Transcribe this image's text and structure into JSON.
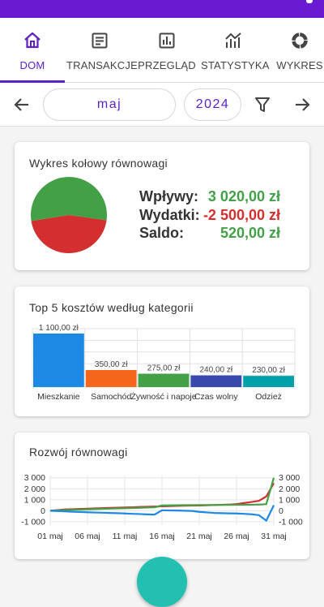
{
  "colors": {
    "status_bar": "#6a1bd1",
    "accent": "#5b21c9",
    "income": "#43a047",
    "expense": "#d32f2f",
    "fab": "#22c0b0"
  },
  "tabs": [
    {
      "label": "DOM",
      "icon": "home-icon",
      "active": true
    },
    {
      "label": "TRANSAKCJE",
      "icon": "list-icon",
      "active": false
    },
    {
      "label": "PRZEGLĄD",
      "icon": "bar-chart-icon",
      "active": false
    },
    {
      "label": "STATYSTYKA",
      "icon": "trend-chart-icon",
      "active": false
    },
    {
      "label": "WYKRES",
      "icon": "donut-chart-icon",
      "active": false
    }
  ],
  "date_filter": {
    "month": "maj",
    "year": "2024",
    "prev_icon": "arrow-left-icon",
    "next_icon": "arrow-right-icon",
    "filter_icon": "filter-icon"
  },
  "balance_card": {
    "title": "Wykres kołowy równowagi",
    "income_label": "Wpływy:",
    "income_value": "3 020,00 zł",
    "expense_label": "Wydatki:",
    "expense_value": "-2 500,00 zł",
    "balance_label": "Saldo:",
    "balance_value": "520,00 zł"
  },
  "top_costs_card": {
    "title": "Top 5 kosztów według kategorii"
  },
  "trend_card": {
    "title": "Rozwój równowagi"
  },
  "chart_data": [
    {
      "type": "pie",
      "title": "Wykres kołowy równowagi",
      "categories": [
        "Wpływy",
        "Wydatki"
      ],
      "values": [
        3020,
        2500
      ],
      "colors": [
        "#43a047",
        "#d32f2f"
      ]
    },
    {
      "type": "bar",
      "title": "Top 5 kosztów według kategorii",
      "categories": [
        "Mieszkanie",
        "Samochód",
        "Żywność i napoje",
        "Czas wolny",
        "Odzież"
      ],
      "values": [
        1100,
        350,
        275,
        240,
        230
      ],
      "data_labels": [
        "1 100,00 zł",
        "350,00 zł",
        "275,00 zł",
        "240,00 zł",
        "230,00 zł"
      ],
      "colors": [
        "#1e88e5",
        "#f4661b",
        "#43a047",
        "#3949ab",
        "#00a0a8"
      ],
      "ylim": [
        0,
        1200
      ],
      "grid": true
    },
    {
      "type": "line",
      "title": "Rozwój równowagi",
      "x": [
        1,
        2,
        3,
        4,
        5,
        6,
        7,
        8,
        9,
        10,
        11,
        12,
        13,
        14,
        15,
        16,
        17,
        18,
        19,
        20,
        21,
        22,
        23,
        24,
        25,
        26,
        27,
        28,
        29,
        30,
        31
      ],
      "x_ticks": [
        "01 maj",
        "06 maj",
        "11 maj",
        "16 maj",
        "21 maj",
        "26 maj",
        "31 maj"
      ],
      "y_ticks_left": [
        "3 000",
        "2 000",
        "1 000",
        "0",
        "-1 000"
      ],
      "y_ticks_right": [
        "3 000",
        "2 000",
        "1 000",
        "0",
        "-1 000"
      ],
      "ylim": [
        -1300,
        3200
      ],
      "grid": true,
      "series": [
        {
          "color": "#d32f2f",
          "values": [
            0,
            60,
            120,
            140,
            170,
            190,
            210,
            230,
            260,
            280,
            300,
            320,
            340,
            360,
            380,
            400,
            420,
            440,
            460,
            470,
            480,
            500,
            520,
            540,
            560,
            600,
            700,
            800,
            900,
            1300,
            2500
          ]
        },
        {
          "color": "#43a047",
          "values": [
            0,
            30,
            60,
            90,
            110,
            130,
            150,
            170,
            190,
            210,
            230,
            250,
            270,
            290,
            310,
            480,
            490,
            500,
            505,
            510,
            515,
            520,
            525,
            530,
            535,
            540,
            545,
            550,
            560,
            600,
            3000
          ]
        },
        {
          "color": "#1e88e5",
          "values": [
            0,
            -30,
            -60,
            -90,
            -110,
            -140,
            -160,
            -180,
            -200,
            -220,
            -250,
            -280,
            -300,
            -330,
            -350,
            40,
            30,
            20,
            0,
            -20,
            -100,
            -150,
            -200,
            -220,
            -240,
            -250,
            -280,
            -320,
            -400,
            -900,
            500
          ]
        }
      ]
    }
  ]
}
